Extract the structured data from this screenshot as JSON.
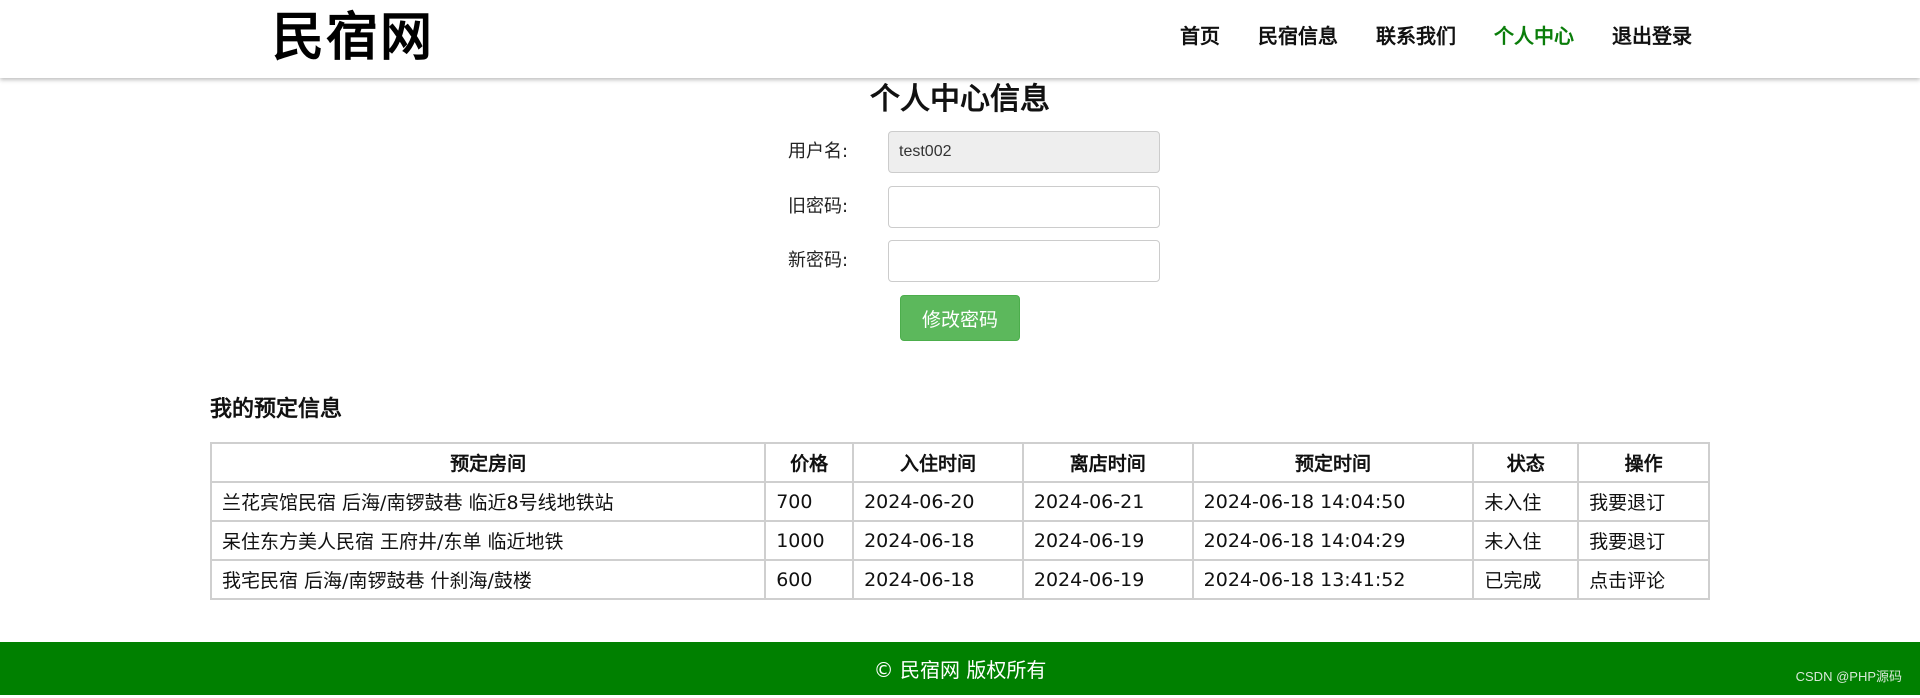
{
  "header": {
    "logo": "民宿网",
    "nav": [
      {
        "label": "首页",
        "active": false
      },
      {
        "label": "民宿信息",
        "active": false
      },
      {
        "label": "联系我们",
        "active": false
      },
      {
        "label": "个人中心",
        "active": true
      },
      {
        "label": "退出登录",
        "active": false
      }
    ],
    "accent_color": "#0a7d0a"
  },
  "profile": {
    "title": "个人中心信息",
    "username_label": "用户名:",
    "username_value": "test002",
    "old_password_label": "旧密码:",
    "old_password_value": "",
    "new_password_label": "新密码:",
    "new_password_value": "",
    "submit_label": "修改密码",
    "button_color": "#5cb85c"
  },
  "bookings": {
    "title": "我的预定信息",
    "columns": [
      "预定房间",
      "价格",
      "入住时间",
      "离店时间",
      "预定时间",
      "状态",
      "操作"
    ],
    "rows": [
      [
        "兰花宾馆民宿 后海/南锣鼓巷 临近8号线地铁站",
        "700",
        "2024-06-20",
        "2024-06-21",
        "2024-06-18 14:04:50",
        "未入住",
        "我要退订"
      ],
      [
        "呆住东方美人民宿 王府井/东单 临近地铁",
        "1000",
        "2024-06-18",
        "2024-06-19",
        "2024-06-18 14:04:29",
        "未入住",
        "我要退订"
      ],
      [
        "我宅民宿 后海/南锣鼓巷 什刹海/鼓楼",
        "600",
        "2024-06-18",
        "2024-06-19",
        "2024-06-18 13:41:52",
        "已完成",
        "点击评论"
      ]
    ]
  },
  "footer": {
    "text": "© 民宿网 版权所有",
    "color": "#008000"
  },
  "watermark": "CSDN @PHP源码"
}
